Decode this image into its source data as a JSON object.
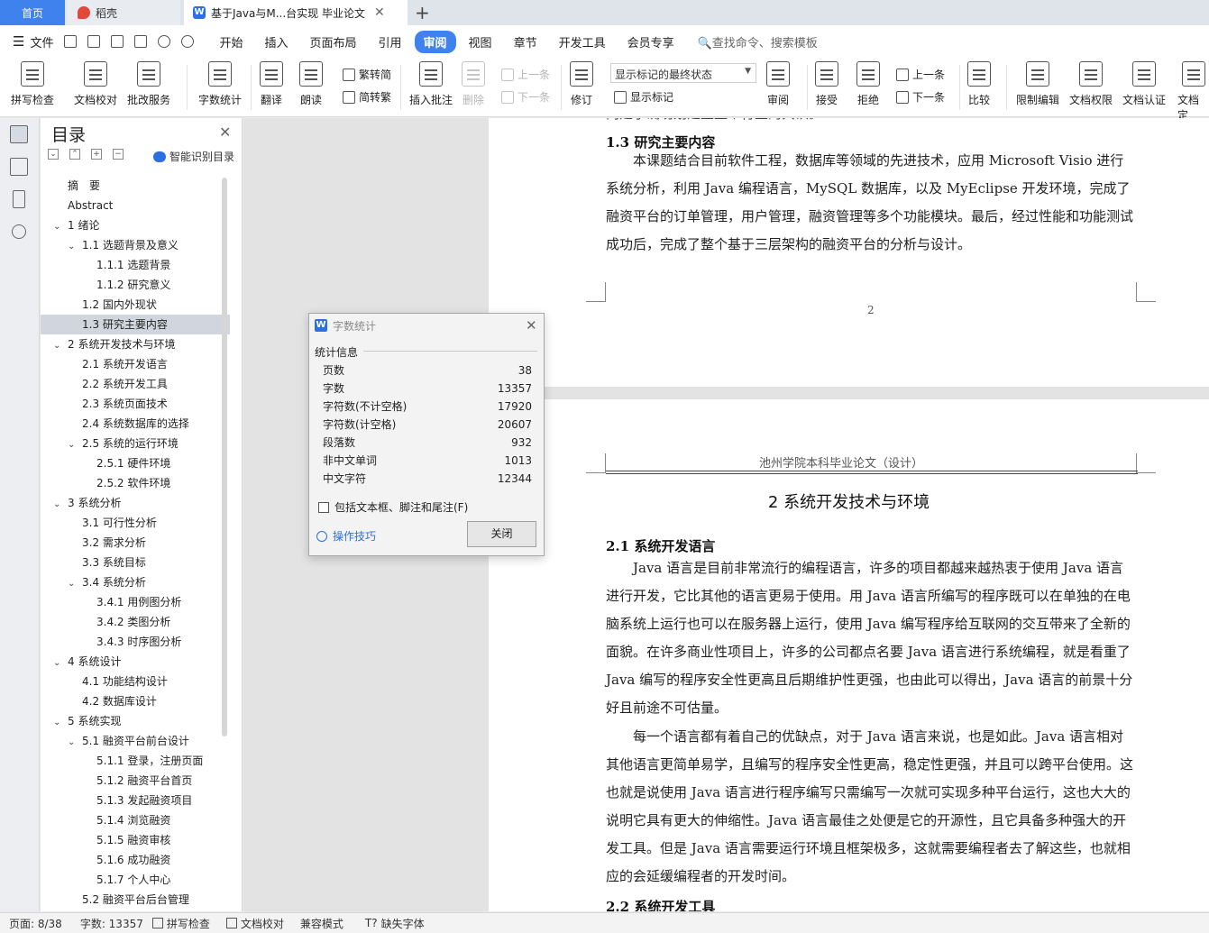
{
  "tabs": {
    "home": "首页",
    "daoke": "稻壳",
    "document": "基于Java与M...台实现 毕业论文",
    "add_label": "+",
    "close_label": "✕"
  },
  "menu": {
    "file": "文件",
    "items": [
      "开始",
      "插入",
      "页面布局",
      "引用",
      "审阅",
      "视图",
      "章节",
      "开发工具",
      "会员专享"
    ],
    "active": "审阅",
    "search_placeholder": "查找命令、搜索模板"
  },
  "ribbon": {
    "spell_check": "拼写检查",
    "doc_proof": "文档校对",
    "batch_service": "批改服务",
    "word_count": "字数统计",
    "translate": "翻译",
    "read_aloud": "朗读",
    "trad_simplified": "繁转简",
    "simplified_trad": "简转繁",
    "insert_comment": "插入批注",
    "delete": "删除",
    "prev": "上一条",
    "next": "下一条",
    "track_changes": "修订",
    "markup_select": "显示标记的最终状态",
    "show_markup": "显示标记",
    "review": "审阅",
    "accept": "接受",
    "reject": "拒绝",
    "prev2": "上一条",
    "next2": "下一条",
    "compare": "比较",
    "restrict_edit": "限制编辑",
    "doc_permission": "文档权限",
    "doc_certify": "文档认证",
    "doc_final": "文档定"
  },
  "toc": {
    "title": "目录",
    "smart_toc": "智能识别目录",
    "items": [
      {
        "label": "摘　要",
        "level": 0,
        "arrow": ""
      },
      {
        "label": "Abstract",
        "level": 0,
        "arrow": ""
      },
      {
        "label": "1 绪论",
        "level": 0,
        "arrow": "v"
      },
      {
        "label": "1.1  选题背景及意义",
        "level": 1,
        "arrow": "v"
      },
      {
        "label": "1.1.1  选题背景",
        "level": 2,
        "arrow": ""
      },
      {
        "label": "1.1.2  研究意义",
        "level": 2,
        "arrow": ""
      },
      {
        "label": "1.2  国内外现状",
        "level": 1,
        "arrow": ""
      },
      {
        "label": "1.3  研究主要内容",
        "level": 1,
        "arrow": "",
        "selected": true
      },
      {
        "label": "2  系统开发技术与环境",
        "level": 0,
        "arrow": "v"
      },
      {
        "label": "2.1  系统开发语言",
        "level": 1,
        "arrow": ""
      },
      {
        "label": "2.2  系统开发工具",
        "level": 1,
        "arrow": ""
      },
      {
        "label": "2.3  系统页面技术",
        "level": 1,
        "arrow": ""
      },
      {
        "label": "2.4  系统数据库的选择",
        "level": 1,
        "arrow": ""
      },
      {
        "label": "2.5  系统的运行环境",
        "level": 1,
        "arrow": "v"
      },
      {
        "label": "2.5.1  硬件环境",
        "level": 2,
        "arrow": ""
      },
      {
        "label": "2.5.2  软件环境",
        "level": 2,
        "arrow": ""
      },
      {
        "label": "3 系统分析",
        "level": 0,
        "arrow": "v"
      },
      {
        "label": "3.1  可行性分析",
        "level": 1,
        "arrow": ""
      },
      {
        "label": "3.2  需求分析",
        "level": 1,
        "arrow": ""
      },
      {
        "label": "3.3  系统目标",
        "level": 1,
        "arrow": ""
      },
      {
        "label": "3.4  系统分析",
        "level": 1,
        "arrow": "v"
      },
      {
        "label": "3.4.1  用例图分析",
        "level": 2,
        "arrow": ""
      },
      {
        "label": "3.4.2  类图分析",
        "level": 2,
        "arrow": ""
      },
      {
        "label": "3.4.3 时序图分析",
        "level": 2,
        "arrow": ""
      },
      {
        "label": "4  系统设计",
        "level": 0,
        "arrow": "v"
      },
      {
        "label": "4.1 功能结构设计",
        "level": 1,
        "arrow": ""
      },
      {
        "label": "4.2 数据库设计",
        "level": 1,
        "arrow": ""
      },
      {
        "label": "5  系统实现",
        "level": 0,
        "arrow": "v"
      },
      {
        "label": "5.1  融资平台前台设计",
        "level": 1,
        "arrow": "v"
      },
      {
        "label": "5.1.1  登录，注册页面",
        "level": 2,
        "arrow": ""
      },
      {
        "label": "5.1.2  融资平台首页",
        "level": 2,
        "arrow": ""
      },
      {
        "label": "5.1.3  发起融资项目",
        "level": 2,
        "arrow": ""
      },
      {
        "label": "5.1.4  浏览融资",
        "level": 2,
        "arrow": ""
      },
      {
        "label": "5.1.5  融资审核",
        "level": 2,
        "arrow": ""
      },
      {
        "label": "5.1.6  成功融资",
        "level": 2,
        "arrow": ""
      },
      {
        "label": "5.1.7  个人中心",
        "level": 2,
        "arrow": ""
      },
      {
        "label": "5.2  融资平台后台管理",
        "level": 1,
        "arrow": ""
      }
    ]
  },
  "document": {
    "page1": {
      "top_cut": "向建了确切划建立整个行业的共识。",
      "heading": "1.3  研究主要内容",
      "paragraph": "本课题结合目前软件工程，数据库等领域的先进技术，应用 Microsoft Visio 进行系统分析，利用 Java 编程语言，MySQL 数据库，以及 MyEclipse 开发环境，完成了融资平台的订单管理，用户管理，融资管理等多个功能模块。最后，经过性能和功能测试成功后，完成了整个基于三层架构的融资平台的分析与设计。",
      "page_number": "2"
    },
    "page2": {
      "running_header": "池州学院本科毕业论文（设计）",
      "chapter_title": "2  系统开发技术与环境",
      "heading": "2.1  系统开发语言",
      "paragraph1": "Java 语言是目前非常流行的编程语言，许多的项目都越来越热衷于使用 Java 语言进行开发，它比其他的语言更易于使用。用 Java 语言所编写的程序既可以在单独的在电脑系统上运行也可以在服务器上运行，使用 Java 编写程序给互联网的交互带来了全新的面貌。在许多商业性项目上，许多的公司都点名要 Java 语言进行系统编程，就是看重了 Java 编写的程序安全性更高且后期维护性更强，也由此可以得出，Java 语言的前景十分好且前途不可估量。",
      "paragraph2": "每一个语言都有着自己的优缺点，对于 Java 语言来说，也是如此。Java 语言相对其他语言更简单易学，且编写的程序安全性更高，稳定性更强，并且可以跨平台使用。这也就是说使用 Java 语言进行程序编写只需编写一次就可实现多种平台运行，这也大大的说明它具有更大的伸缩性。Java 语言最佳之处便是它的开源性，且它具备多种强大的开发工具。但是 Java 语言需要运行环境且框架极多，这就需要编程者去了解这些，也就相应的会延缓编程者的开发时间。",
      "next_heading": "2.2  系统开发工具"
    }
  },
  "dialog": {
    "title": "字数统计",
    "section_label": "统计信息",
    "stats": [
      {
        "label": "页数",
        "value": "38"
      },
      {
        "label": "字数",
        "value": "13357"
      },
      {
        "label": "字符数(不计空格)",
        "value": "17920"
      },
      {
        "label": "字符数(计空格)",
        "value": "20607"
      },
      {
        "label": "段落数",
        "value": "932"
      },
      {
        "label": "非中文单词",
        "value": "1013"
      },
      {
        "label": "中文字符",
        "value": "12344"
      }
    ],
    "include_label": "包括文本框、脚注和尾注(F)",
    "include_checked": false,
    "tips_label": "操作技巧",
    "close_button": "关闭"
  },
  "status": {
    "page": "页面: 8/38",
    "words": "字数: 13357",
    "spell": "拼写检查",
    "proof": "文档校对",
    "compat": "兼容模式",
    "missing_font": "缺失字体"
  }
}
